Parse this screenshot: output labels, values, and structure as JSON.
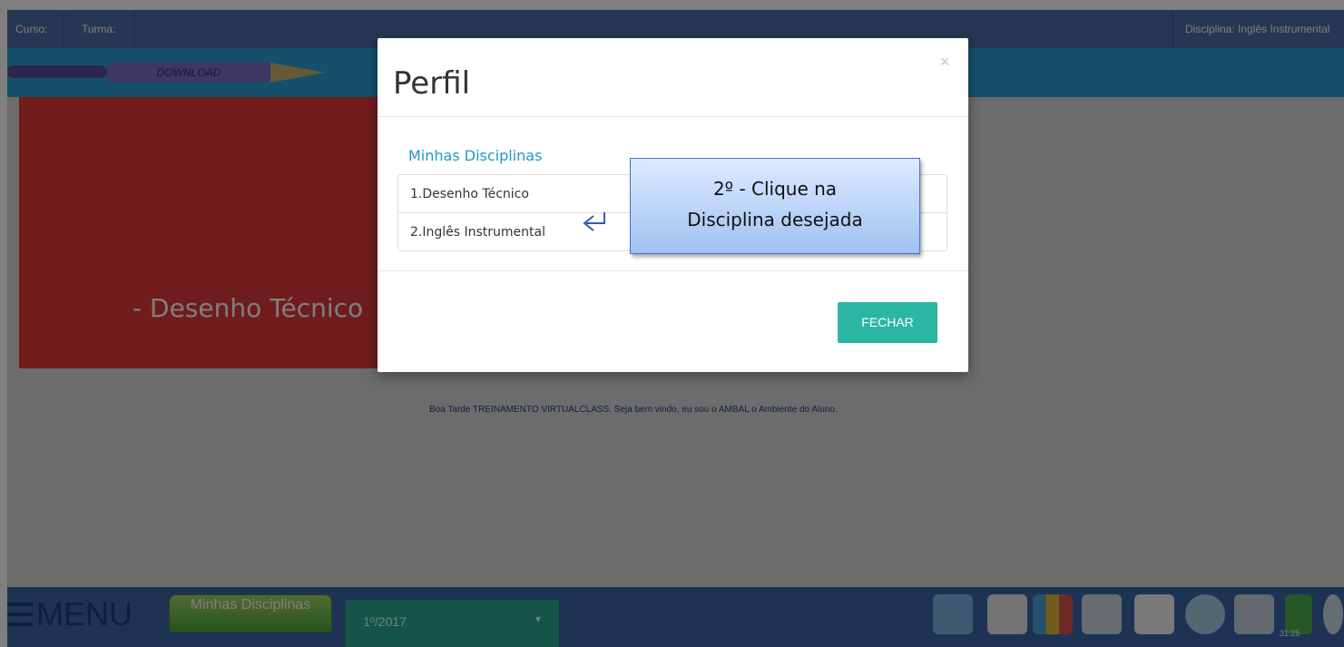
{
  "topbar": {
    "curso_label": "Curso:",
    "turma_label": "Turma:",
    "disciplina_label": "Disciplina: Inglês Instrumental"
  },
  "banner": {
    "download_label": "DOWNLOAD"
  },
  "hero": {
    "title": "- Desenho Técnico"
  },
  "welcome_text": "Boa Tarde TREINAMENTO VIRTUALCLASS. Seja bem vindo, eu sou o AMBAL o Ambiente do Aluno.",
  "bottombar": {
    "menu_label": "MENU",
    "disciplinas_button": "Minhas Disciplinas",
    "year_selected": "1º/2017",
    "timer": "31:25",
    "icons": [
      "edit-tools-icon",
      "document-icon",
      "binders-icon",
      "media-icon",
      "notebook-icon",
      "chat-icon",
      "tools-icon",
      "lock-icon",
      "power-icon"
    ]
  },
  "modal": {
    "title": "Perfil",
    "close_symbol": "×",
    "section_title": "Minhas Disciplinas",
    "items": [
      {
        "label": "1.Desenho Técnico"
      },
      {
        "label": "2.Inglês Instrumental"
      }
    ],
    "close_button": "FECHAR"
  },
  "callout": {
    "line1": "2º - Clique na",
    "line2": "Disciplina desejada"
  },
  "colors": {
    "topbar": "#4a6fa5",
    "subbar": "#2c9fd6",
    "hero": "#e0383b",
    "accent": "#2bb5a3",
    "link": "#2196c9"
  }
}
